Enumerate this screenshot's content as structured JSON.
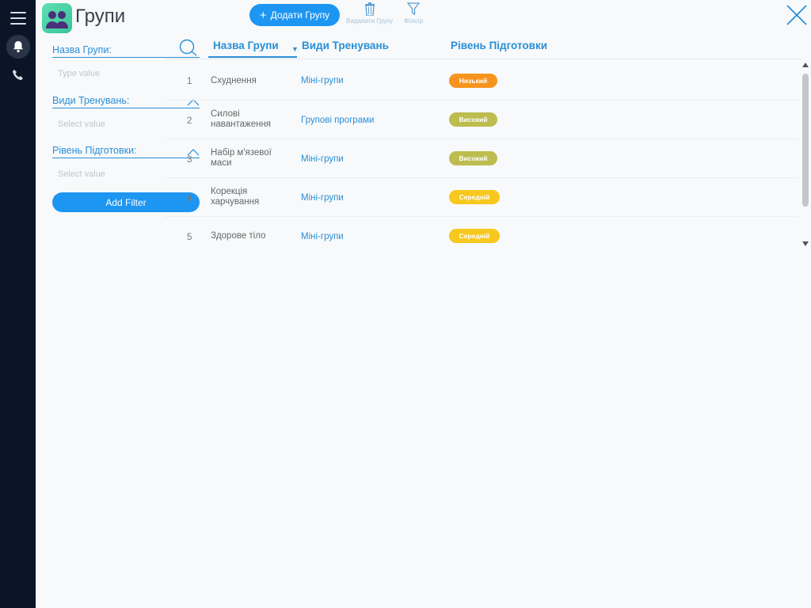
{
  "header": {
    "title": "Групи",
    "add_button": "Додати Групу",
    "delete_label": "Видалити Групу",
    "filter_label": "Фільтр"
  },
  "filters": {
    "group_name": {
      "label": "Назва Групи:",
      "placeholder": "Type value"
    },
    "training_types": {
      "label": "Види Тренувань:",
      "placeholder": "Select value"
    },
    "level": {
      "label": "Рівень Підготовки:",
      "placeholder": "Select value"
    },
    "add_filter": "Add Filter"
  },
  "table": {
    "columns": [
      "Назва Групи",
      "Види Тренувань",
      "Рівень Підготовки"
    ],
    "rows": [
      {
        "index": "1",
        "name": "Схуднення",
        "type": "Міні-групи",
        "level": "Низький",
        "level_color": "#f7941d"
      },
      {
        "index": "2",
        "name": "Силові навантаження",
        "type": "Групові програми",
        "level": "Високий",
        "level_color": "#bcbd4e"
      },
      {
        "index": "3",
        "name": "Набір м'язевої маси",
        "type": "Міні-групи",
        "level": "Високий",
        "level_color": "#bcbd4e"
      },
      {
        "index": "4",
        "name": "Корекція харчування",
        "type": "Міні-групи",
        "level": "Середній",
        "level_color": "#f7c81e"
      },
      {
        "index": "5",
        "name": "Здорове тіло",
        "type": "Міні-групи",
        "level": "Середній",
        "level_color": "#f7c81e"
      }
    ]
  },
  "icons": {
    "menu": "hamburger-icon",
    "bell": "bell-icon",
    "phone": "phone-icon",
    "app": "users-icon",
    "add": "plus-icon",
    "delete": "trash-icon",
    "filter": "funnel-icon",
    "close": "close-icon",
    "search": "search-icon"
  }
}
